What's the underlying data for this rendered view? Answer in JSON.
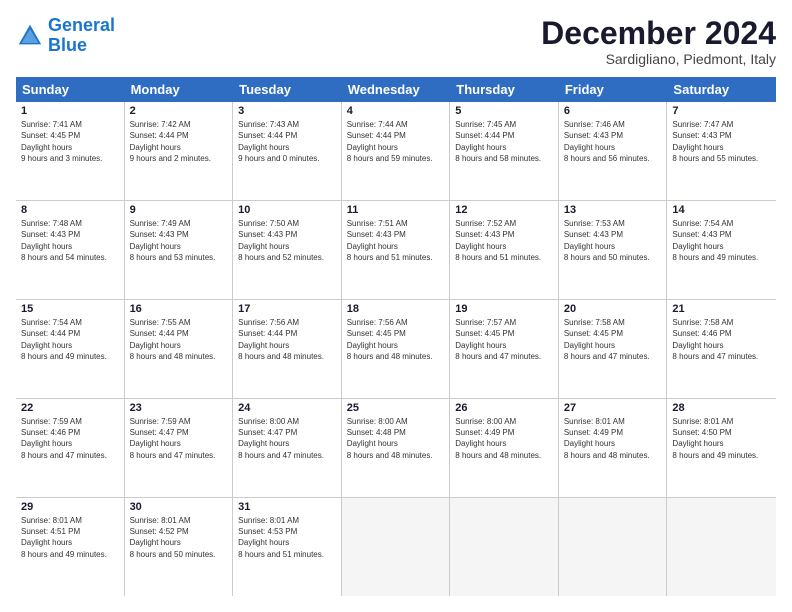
{
  "logo": {
    "line1": "General",
    "line2": "Blue"
  },
  "title": "December 2024",
  "subtitle": "Sardigliano, Piedmont, Italy",
  "days": [
    "Sunday",
    "Monday",
    "Tuesday",
    "Wednesday",
    "Thursday",
    "Friday",
    "Saturday"
  ],
  "weeks": [
    [
      {
        "day": "1",
        "sunrise": "7:41 AM",
        "sunset": "4:45 PM",
        "daylight": "9 hours and 3 minutes."
      },
      {
        "day": "2",
        "sunrise": "7:42 AM",
        "sunset": "4:44 PM",
        "daylight": "9 hours and 2 minutes."
      },
      {
        "day": "3",
        "sunrise": "7:43 AM",
        "sunset": "4:44 PM",
        "daylight": "9 hours and 0 minutes."
      },
      {
        "day": "4",
        "sunrise": "7:44 AM",
        "sunset": "4:44 PM",
        "daylight": "8 hours and 59 minutes."
      },
      {
        "day": "5",
        "sunrise": "7:45 AM",
        "sunset": "4:44 PM",
        "daylight": "8 hours and 58 minutes."
      },
      {
        "day": "6",
        "sunrise": "7:46 AM",
        "sunset": "4:43 PM",
        "daylight": "8 hours and 56 minutes."
      },
      {
        "day": "7",
        "sunrise": "7:47 AM",
        "sunset": "4:43 PM",
        "daylight": "8 hours and 55 minutes."
      }
    ],
    [
      {
        "day": "8",
        "sunrise": "7:48 AM",
        "sunset": "4:43 PM",
        "daylight": "8 hours and 54 minutes."
      },
      {
        "day": "9",
        "sunrise": "7:49 AM",
        "sunset": "4:43 PM",
        "daylight": "8 hours and 53 minutes."
      },
      {
        "day": "10",
        "sunrise": "7:50 AM",
        "sunset": "4:43 PM",
        "daylight": "8 hours and 52 minutes."
      },
      {
        "day": "11",
        "sunrise": "7:51 AM",
        "sunset": "4:43 PM",
        "daylight": "8 hours and 51 minutes."
      },
      {
        "day": "12",
        "sunrise": "7:52 AM",
        "sunset": "4:43 PM",
        "daylight": "8 hours and 51 minutes."
      },
      {
        "day": "13",
        "sunrise": "7:53 AM",
        "sunset": "4:43 PM",
        "daylight": "8 hours and 50 minutes."
      },
      {
        "day": "14",
        "sunrise": "7:54 AM",
        "sunset": "4:43 PM",
        "daylight": "8 hours and 49 minutes."
      }
    ],
    [
      {
        "day": "15",
        "sunrise": "7:54 AM",
        "sunset": "4:44 PM",
        "daylight": "8 hours and 49 minutes."
      },
      {
        "day": "16",
        "sunrise": "7:55 AM",
        "sunset": "4:44 PM",
        "daylight": "8 hours and 48 minutes."
      },
      {
        "day": "17",
        "sunrise": "7:56 AM",
        "sunset": "4:44 PM",
        "daylight": "8 hours and 48 minutes."
      },
      {
        "day": "18",
        "sunrise": "7:56 AM",
        "sunset": "4:45 PM",
        "daylight": "8 hours and 48 minutes."
      },
      {
        "day": "19",
        "sunrise": "7:57 AM",
        "sunset": "4:45 PM",
        "daylight": "8 hours and 47 minutes."
      },
      {
        "day": "20",
        "sunrise": "7:58 AM",
        "sunset": "4:45 PM",
        "daylight": "8 hours and 47 minutes."
      },
      {
        "day": "21",
        "sunrise": "7:58 AM",
        "sunset": "4:46 PM",
        "daylight": "8 hours and 47 minutes."
      }
    ],
    [
      {
        "day": "22",
        "sunrise": "7:59 AM",
        "sunset": "4:46 PM",
        "daylight": "8 hours and 47 minutes."
      },
      {
        "day": "23",
        "sunrise": "7:59 AM",
        "sunset": "4:47 PM",
        "daylight": "8 hours and 47 minutes."
      },
      {
        "day": "24",
        "sunrise": "8:00 AM",
        "sunset": "4:47 PM",
        "daylight": "8 hours and 47 minutes."
      },
      {
        "day": "25",
        "sunrise": "8:00 AM",
        "sunset": "4:48 PM",
        "daylight": "8 hours and 48 minutes."
      },
      {
        "day": "26",
        "sunrise": "8:00 AM",
        "sunset": "4:49 PM",
        "daylight": "8 hours and 48 minutes."
      },
      {
        "day": "27",
        "sunrise": "8:01 AM",
        "sunset": "4:49 PM",
        "daylight": "8 hours and 48 minutes."
      },
      {
        "day": "28",
        "sunrise": "8:01 AM",
        "sunset": "4:50 PM",
        "daylight": "8 hours and 49 minutes."
      }
    ],
    [
      {
        "day": "29",
        "sunrise": "8:01 AM",
        "sunset": "4:51 PM",
        "daylight": "8 hours and 49 minutes."
      },
      {
        "day": "30",
        "sunrise": "8:01 AM",
        "sunset": "4:52 PM",
        "daylight": "8 hours and 50 minutes."
      },
      {
        "day": "31",
        "sunrise": "8:01 AM",
        "sunset": "4:53 PM",
        "daylight": "8 hours and 51 minutes."
      },
      null,
      null,
      null,
      null
    ]
  ]
}
